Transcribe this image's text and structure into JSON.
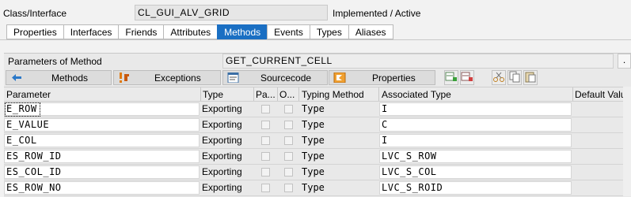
{
  "header": {
    "class_label": "Class/Interface",
    "class_value": "CL_GUI_ALV_GRID",
    "status": "Implemented / Active"
  },
  "tabs": [
    {
      "label": "Properties"
    },
    {
      "label": "Interfaces"
    },
    {
      "label": "Friends"
    },
    {
      "label": "Attributes"
    },
    {
      "label": "Methods",
      "active": true
    },
    {
      "label": "Events"
    },
    {
      "label": "Types"
    },
    {
      "label": "Aliases"
    }
  ],
  "panel": {
    "label": "Parameters of Method",
    "method_value": "GET_CURRENT_CELL",
    "small_button": "."
  },
  "nav": {
    "methods": "Methods",
    "exceptions": "Exceptions",
    "sourcecode": "Sourcecode",
    "properties": "Properties"
  },
  "table": {
    "headers": {
      "parameter": "Parameter",
      "type": "Type",
      "pass": "Pa...",
      "optional": "O...",
      "typing": "Typing Method",
      "assoc": "Associated Type",
      "default": "Default Valu"
    },
    "rows": [
      {
        "name": "E_ROW",
        "type": "Exporting",
        "typing": "Type",
        "assoc": "I"
      },
      {
        "name": "E_VALUE",
        "type": "Exporting",
        "typing": "Type",
        "assoc": "C"
      },
      {
        "name": "E_COL",
        "type": "Exporting",
        "typing": "Type",
        "assoc": "I"
      },
      {
        "name": "ES_ROW_ID",
        "type": "Exporting",
        "typing": "Type",
        "assoc": "LVC_S_ROW"
      },
      {
        "name": "ES_COL_ID",
        "type": "Exporting",
        "typing": "Type",
        "assoc": "LVC_S_COL"
      },
      {
        "name": "ES_ROW_NO",
        "type": "Exporting",
        "typing": "Type",
        "assoc": "LVC_S_ROID"
      }
    ]
  },
  "colors": {
    "active_tab": "#1a6fc3"
  }
}
